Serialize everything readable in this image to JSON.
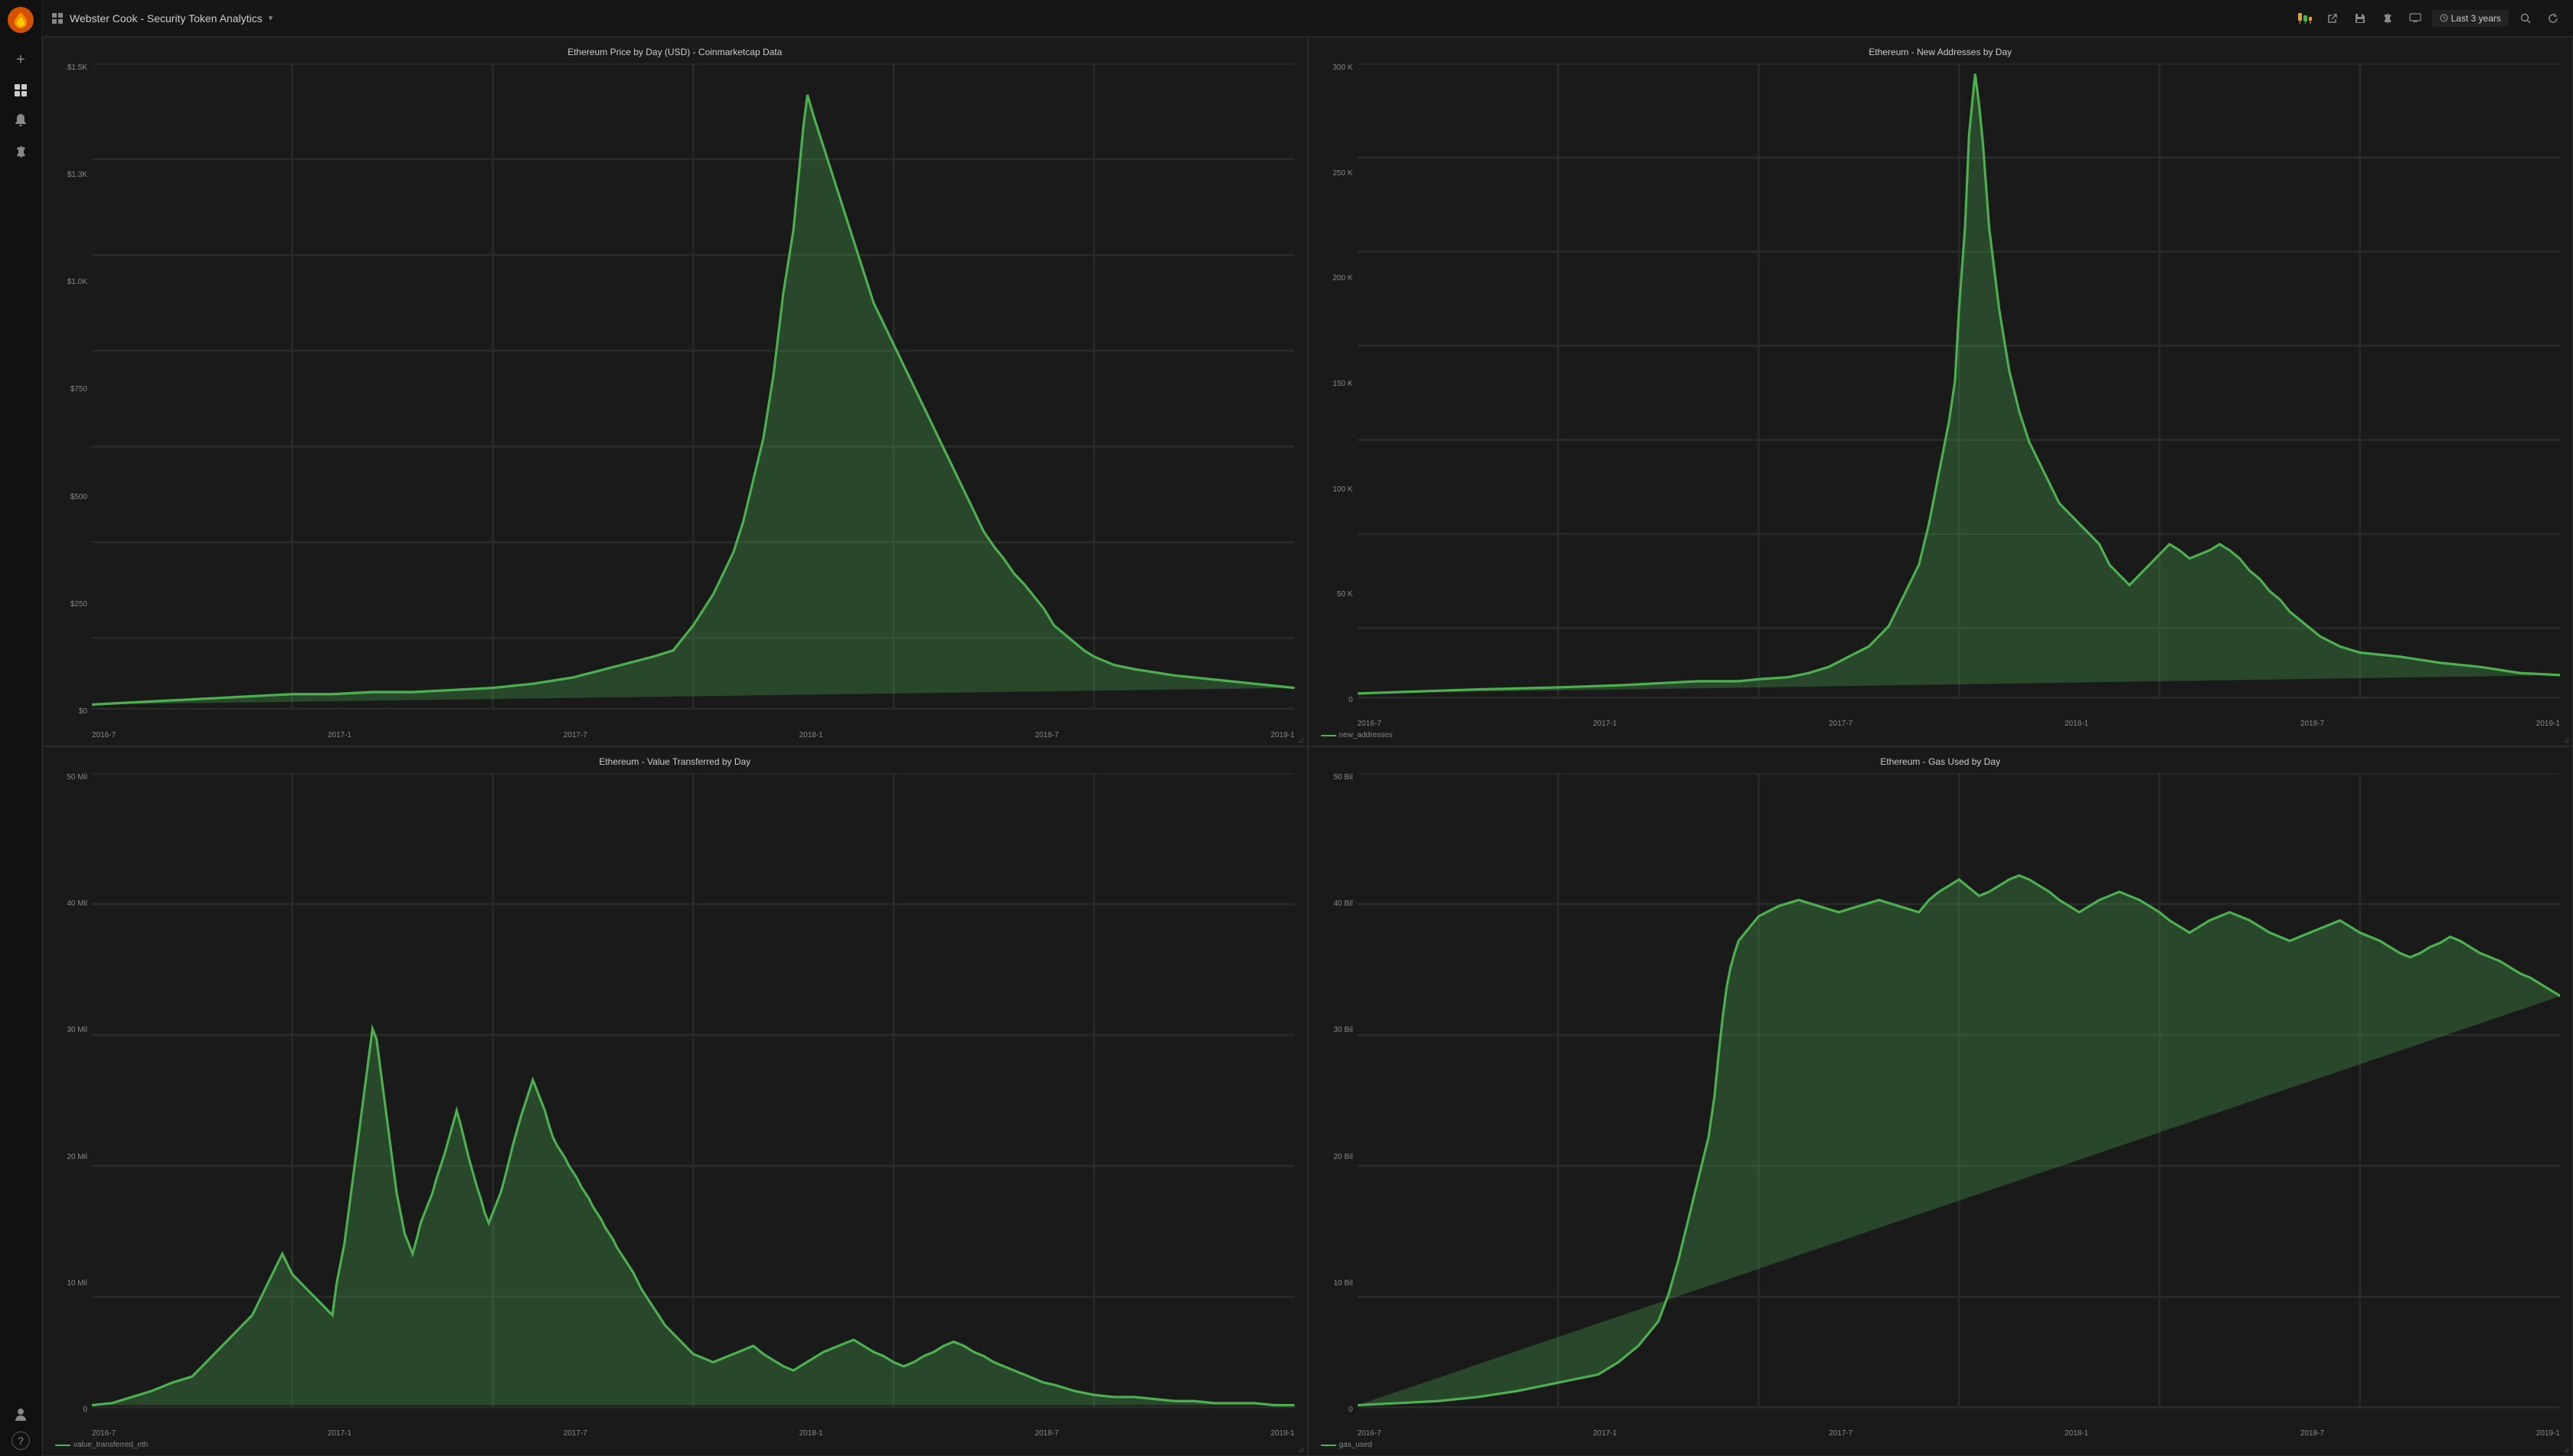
{
  "app": {
    "logo_icon": "🔥",
    "title": "Webster Cook - Security Token Analytics",
    "title_dropdown": true
  },
  "topbar": {
    "actions": [
      {
        "name": "chart-icon",
        "icon": "📊",
        "label": "Chart settings"
      },
      {
        "name": "share-icon",
        "icon": "↗",
        "label": "Share"
      },
      {
        "name": "save-icon",
        "icon": "💾",
        "label": "Save"
      },
      {
        "name": "settings-icon",
        "icon": "⚙",
        "label": "Settings"
      },
      {
        "name": "monitor-icon",
        "icon": "🖥",
        "label": "Monitor"
      }
    ],
    "time_filter": "Last 3 years",
    "search_icon": "🔍",
    "refresh_icon": "↺"
  },
  "sidebar": {
    "items": [
      {
        "name": "add-icon",
        "icon": "+",
        "label": "Add"
      },
      {
        "name": "dashboard-icon",
        "icon": "⊞",
        "label": "Dashboard"
      },
      {
        "name": "bell-icon",
        "icon": "🔔",
        "label": "Alerts"
      },
      {
        "name": "gear-icon",
        "icon": "⚙",
        "label": "Settings"
      }
    ],
    "bottom_items": [
      {
        "name": "user-icon",
        "icon": "👤",
        "label": "Profile"
      },
      {
        "name": "help-icon",
        "icon": "?",
        "label": "Help"
      }
    ]
  },
  "charts": [
    {
      "id": "eth-price",
      "title": "Ethereum Price by Day (USD) - Coinmarketcap Data",
      "y_axis": [
        "$1.5K",
        "$1.3K",
        "$1.0K",
        "$750",
        "$500",
        "$250",
        "$0"
      ],
      "x_axis": [
        "2016-7",
        "2017-1",
        "2017-7",
        "2018-1",
        "2018-7",
        "2019-1"
      ],
      "legend_key": null,
      "position": "top-left"
    },
    {
      "id": "eth-new-addresses",
      "title": "Ethereum - New Addresses by Day",
      "y_axis": [
        "300 K",
        "250 K",
        "200 K",
        "150 K",
        "100 K",
        "50 K",
        "0"
      ],
      "x_axis": [
        "2016-7",
        "2017-1",
        "2017-7",
        "2018-1",
        "2018-7",
        "2019-1"
      ],
      "legend_key": "new_addresses",
      "position": "top-right"
    },
    {
      "id": "eth-value-transferred",
      "title": "Ethereum - Value Transferred by Day",
      "y_axis": [
        "50 Mil",
        "40 Mil",
        "30 Mil",
        "20 Mil",
        "10 Mil",
        "0"
      ],
      "x_axis": [
        "2016-7",
        "2017-1",
        "2017-7",
        "2018-1",
        "2018-7",
        "2019-1"
      ],
      "legend_key": "value_transferred_eth",
      "position": "bottom-left"
    },
    {
      "id": "eth-gas-used",
      "title": "Ethereum - Gas Used by Day",
      "y_axis": [
        "50 Bil",
        "40 Bil",
        "30 Bil",
        "20 Bil",
        "10 Bil",
        "0"
      ],
      "x_axis": [
        "2016-7",
        "2017-1",
        "2017-7",
        "2018-1",
        "2018-7",
        "2019-1"
      ],
      "legend_key": "gas_used",
      "position": "bottom-right"
    }
  ],
  "colors": {
    "background": "#161616",
    "panel": "#1a1a1a",
    "border": "#2a2a2a",
    "accent_green": "#4caf50",
    "text_primary": "#cccccc",
    "text_secondary": "#888888"
  }
}
